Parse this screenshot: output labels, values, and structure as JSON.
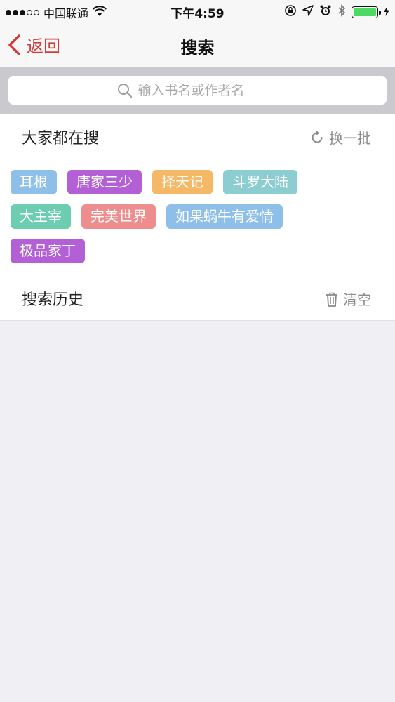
{
  "status_bar": {
    "carrier": "中国联通",
    "time": "下午4:59"
  },
  "nav": {
    "back_label": "返回",
    "title": "搜索"
  },
  "search": {
    "placeholder": "输入书名或作者名"
  },
  "hot": {
    "title": "大家都在搜",
    "refresh_label": "换一批",
    "rows": [
      [
        {
          "label": "耳根",
          "color": "#8dbfe8"
        },
        {
          "label": "唐家三少",
          "color": "#b35fd6"
        },
        {
          "label": "择天记",
          "color": "#f5b867"
        },
        {
          "label": "斗罗大陆",
          "color": "#8ccdd2"
        }
      ],
      [
        {
          "label": "大主宰",
          "color": "#6ccdb0"
        },
        {
          "label": "完美世界",
          "color": "#ee8d8d"
        },
        {
          "label": "如果蜗牛有爱情",
          "color": "#8dbfe8"
        }
      ],
      [
        {
          "label": "极品家丁",
          "color": "#b35fd6"
        }
      ]
    ]
  },
  "history": {
    "title": "搜索历史",
    "clear_label": "清空"
  }
}
